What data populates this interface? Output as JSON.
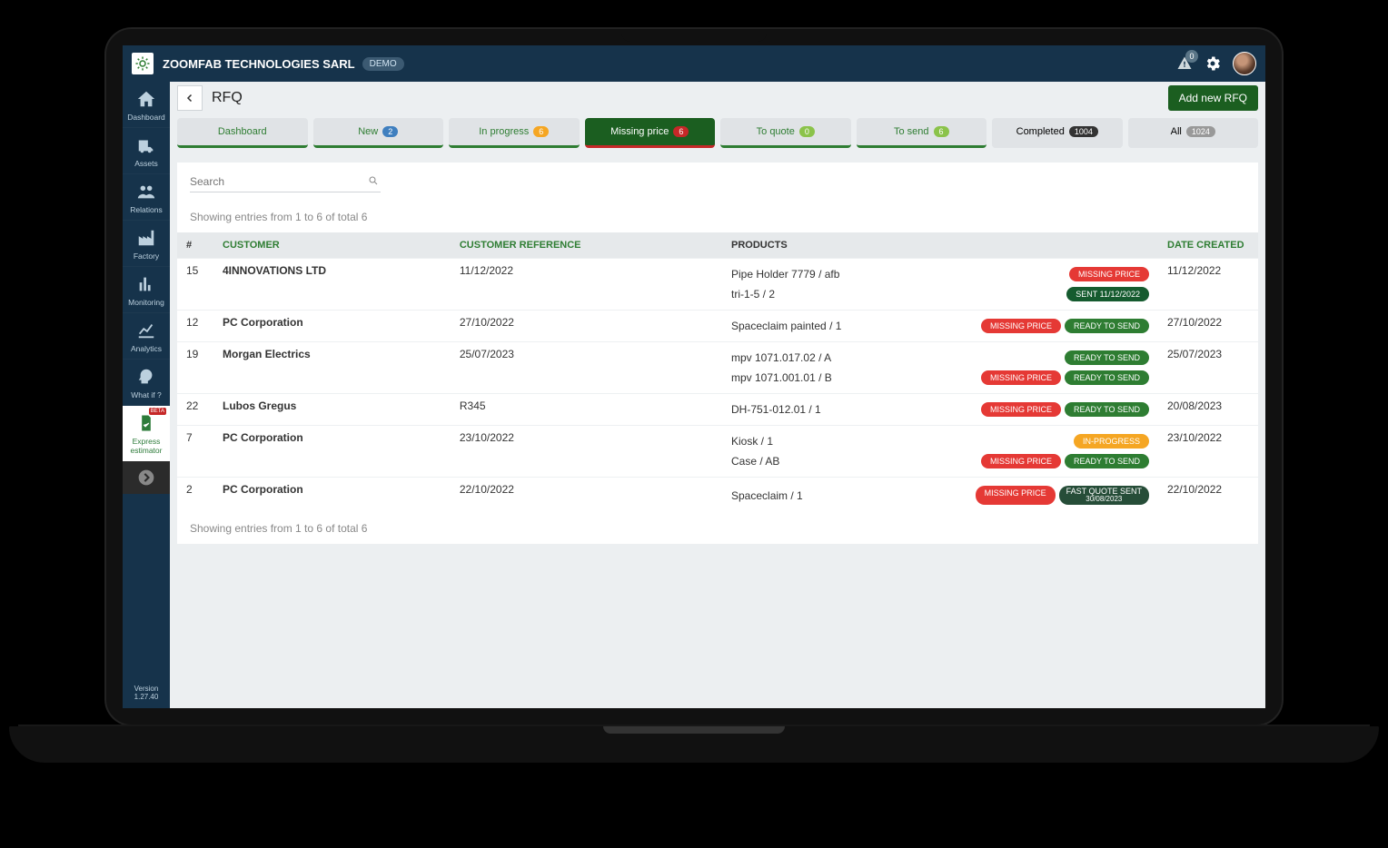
{
  "topbar": {
    "company": "ZOOMFAB TECHNOLOGIES SARL",
    "demo_badge": "DEMO",
    "alert_count": "0"
  },
  "sidebar": {
    "items": [
      {
        "label": "Dashboard",
        "key": "dashboard"
      },
      {
        "label": "Assets",
        "key": "assets"
      },
      {
        "label": "Relations",
        "key": "relations"
      },
      {
        "label": "Factory",
        "key": "factory"
      },
      {
        "label": "Monitoring",
        "key": "monitoring"
      },
      {
        "label": "Analytics",
        "key": "analytics"
      },
      {
        "label": "What if ?",
        "key": "whatif"
      },
      {
        "label": "Express estimator",
        "key": "express",
        "beta": "BETA"
      }
    ],
    "version_label": "Version",
    "version": "1.27.40"
  },
  "page": {
    "title": "RFQ",
    "add_button": "Add new RFQ",
    "search_placeholder": "Search",
    "entries_text_top": "Showing entries from 1 to 6 of total 6",
    "entries_text_bottom": "Showing entries from 1 to 6 of total 6"
  },
  "tabs": [
    {
      "label": "Dashboard",
      "count": null
    },
    {
      "label": "New",
      "count": "2"
    },
    {
      "label": "In progress",
      "count": "6"
    },
    {
      "label": "Missing price",
      "count": "6",
      "active": true
    },
    {
      "label": "To quote",
      "count": "0"
    },
    {
      "label": "To send",
      "count": "6"
    },
    {
      "label": "Completed",
      "count": "1004"
    },
    {
      "label": "All",
      "count": "1024"
    }
  ],
  "columns": {
    "num": "#",
    "customer": "CUSTOMER",
    "reference": "CUSTOMER REFERENCE",
    "products": "PRODUCTS",
    "date": "DATE CREATED"
  },
  "badges": {
    "missing": "MISSING PRICE",
    "sent_11": "SENT 11/12/2022",
    "ready": "READY TO SEND",
    "inprog": "IN-PROGRESS",
    "fast_top": "FAST QUOTE SENT",
    "fast_sub": "30/08/2023"
  },
  "rows": [
    {
      "id": "15",
      "customer": "4INNOVATIONS LTD",
      "reference": "11/12/2022",
      "date": "11/12/2022",
      "products": [
        {
          "name": "Pipe Holder 7779 / afb",
          "badges": [
            {
              "t": "missing",
              "c": "b-red"
            }
          ]
        },
        {
          "name": "tri-1-5 / 2",
          "badges": [
            {
              "t": "sent_11",
              "c": "b-darkgreen"
            }
          ]
        }
      ]
    },
    {
      "id": "12",
      "customer": "PC Corporation",
      "reference": "27/10/2022",
      "date": "27/10/2022",
      "products": [
        {
          "name": "Spaceclaim painted / 1",
          "badges": [
            {
              "t": "missing",
              "c": "b-red"
            },
            {
              "t": "ready",
              "c": "b-green"
            }
          ]
        }
      ]
    },
    {
      "id": "19",
      "customer": "Morgan Electrics",
      "reference": "25/07/2023",
      "date": "25/07/2023",
      "products": [
        {
          "name": "mpv 1071.017.02 / A",
          "badges": [
            {
              "t": "ready",
              "c": "b-green"
            }
          ]
        },
        {
          "name": "mpv 1071.001.01 / B",
          "badges": [
            {
              "t": "missing",
              "c": "b-red"
            },
            {
              "t": "ready",
              "c": "b-green"
            }
          ]
        }
      ]
    },
    {
      "id": "22",
      "customer": "Lubos Gregus",
      "reference": "R345",
      "date": "20/08/2023",
      "products": [
        {
          "name": "DH-751-012.01 / 1",
          "badges": [
            {
              "t": "missing",
              "c": "b-red"
            },
            {
              "t": "ready",
              "c": "b-green"
            }
          ]
        }
      ]
    },
    {
      "id": "7",
      "customer": "PC Corporation",
      "reference": "23/10/2022",
      "date": "23/10/2022",
      "products": [
        {
          "name": "Kiosk / 1",
          "badges": [
            {
              "t": "inprog",
              "c": "b-orange"
            }
          ]
        },
        {
          "name": "Case / AB",
          "badges": [
            {
              "t": "missing",
              "c": "b-red"
            },
            {
              "t": "ready",
              "c": "b-green"
            }
          ]
        }
      ]
    },
    {
      "id": "2",
      "customer": "PC Corporation",
      "reference": "22/10/2022",
      "date": "22/10/2022",
      "products": [
        {
          "name": "Spaceclaim / 1",
          "badges": [
            {
              "t": "missing",
              "c": "b-red"
            },
            {
              "t": "fast",
              "c": "b-dark"
            }
          ]
        }
      ]
    }
  ]
}
